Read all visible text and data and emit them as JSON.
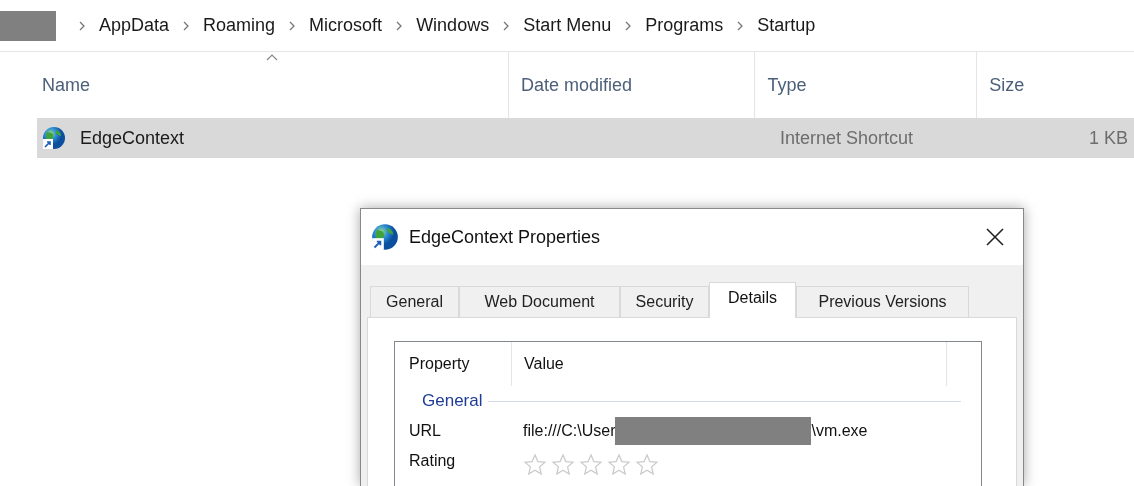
{
  "breadcrumb": [
    "AppData",
    "Roaming",
    "Microsoft",
    "Windows",
    "Start Menu",
    "Programs",
    "Startup"
  ],
  "file_list": {
    "columns": [
      {
        "label": "Name",
        "sorted": true
      },
      {
        "label": "Date modified",
        "sorted": false
      },
      {
        "label": "Type",
        "sorted": false
      },
      {
        "label": "Size",
        "sorted": false
      }
    ],
    "rows": [
      {
        "name": "EdgeContext",
        "date_modified": "",
        "type": "Internet Shortcut",
        "size": "1 KB",
        "selected": true
      }
    ]
  },
  "dialog": {
    "title": "EdgeContext Properties",
    "tabs": [
      {
        "label": "General",
        "selected": false
      },
      {
        "label": "Web Document",
        "selected": false
      },
      {
        "label": "Security",
        "selected": false
      },
      {
        "label": "Details",
        "selected": true
      },
      {
        "label": "Previous Versions",
        "selected": false
      }
    ],
    "details": {
      "columns": [
        "Property",
        "Value"
      ],
      "group": "General",
      "rows": [
        {
          "kind": "text",
          "property": "URL",
          "value": "file:///C:\\User",
          "value_end": "\\vm.exe"
        },
        {
          "kind": "rating",
          "property": "Rating",
          "stars": 0
        }
      ]
    }
  }
}
